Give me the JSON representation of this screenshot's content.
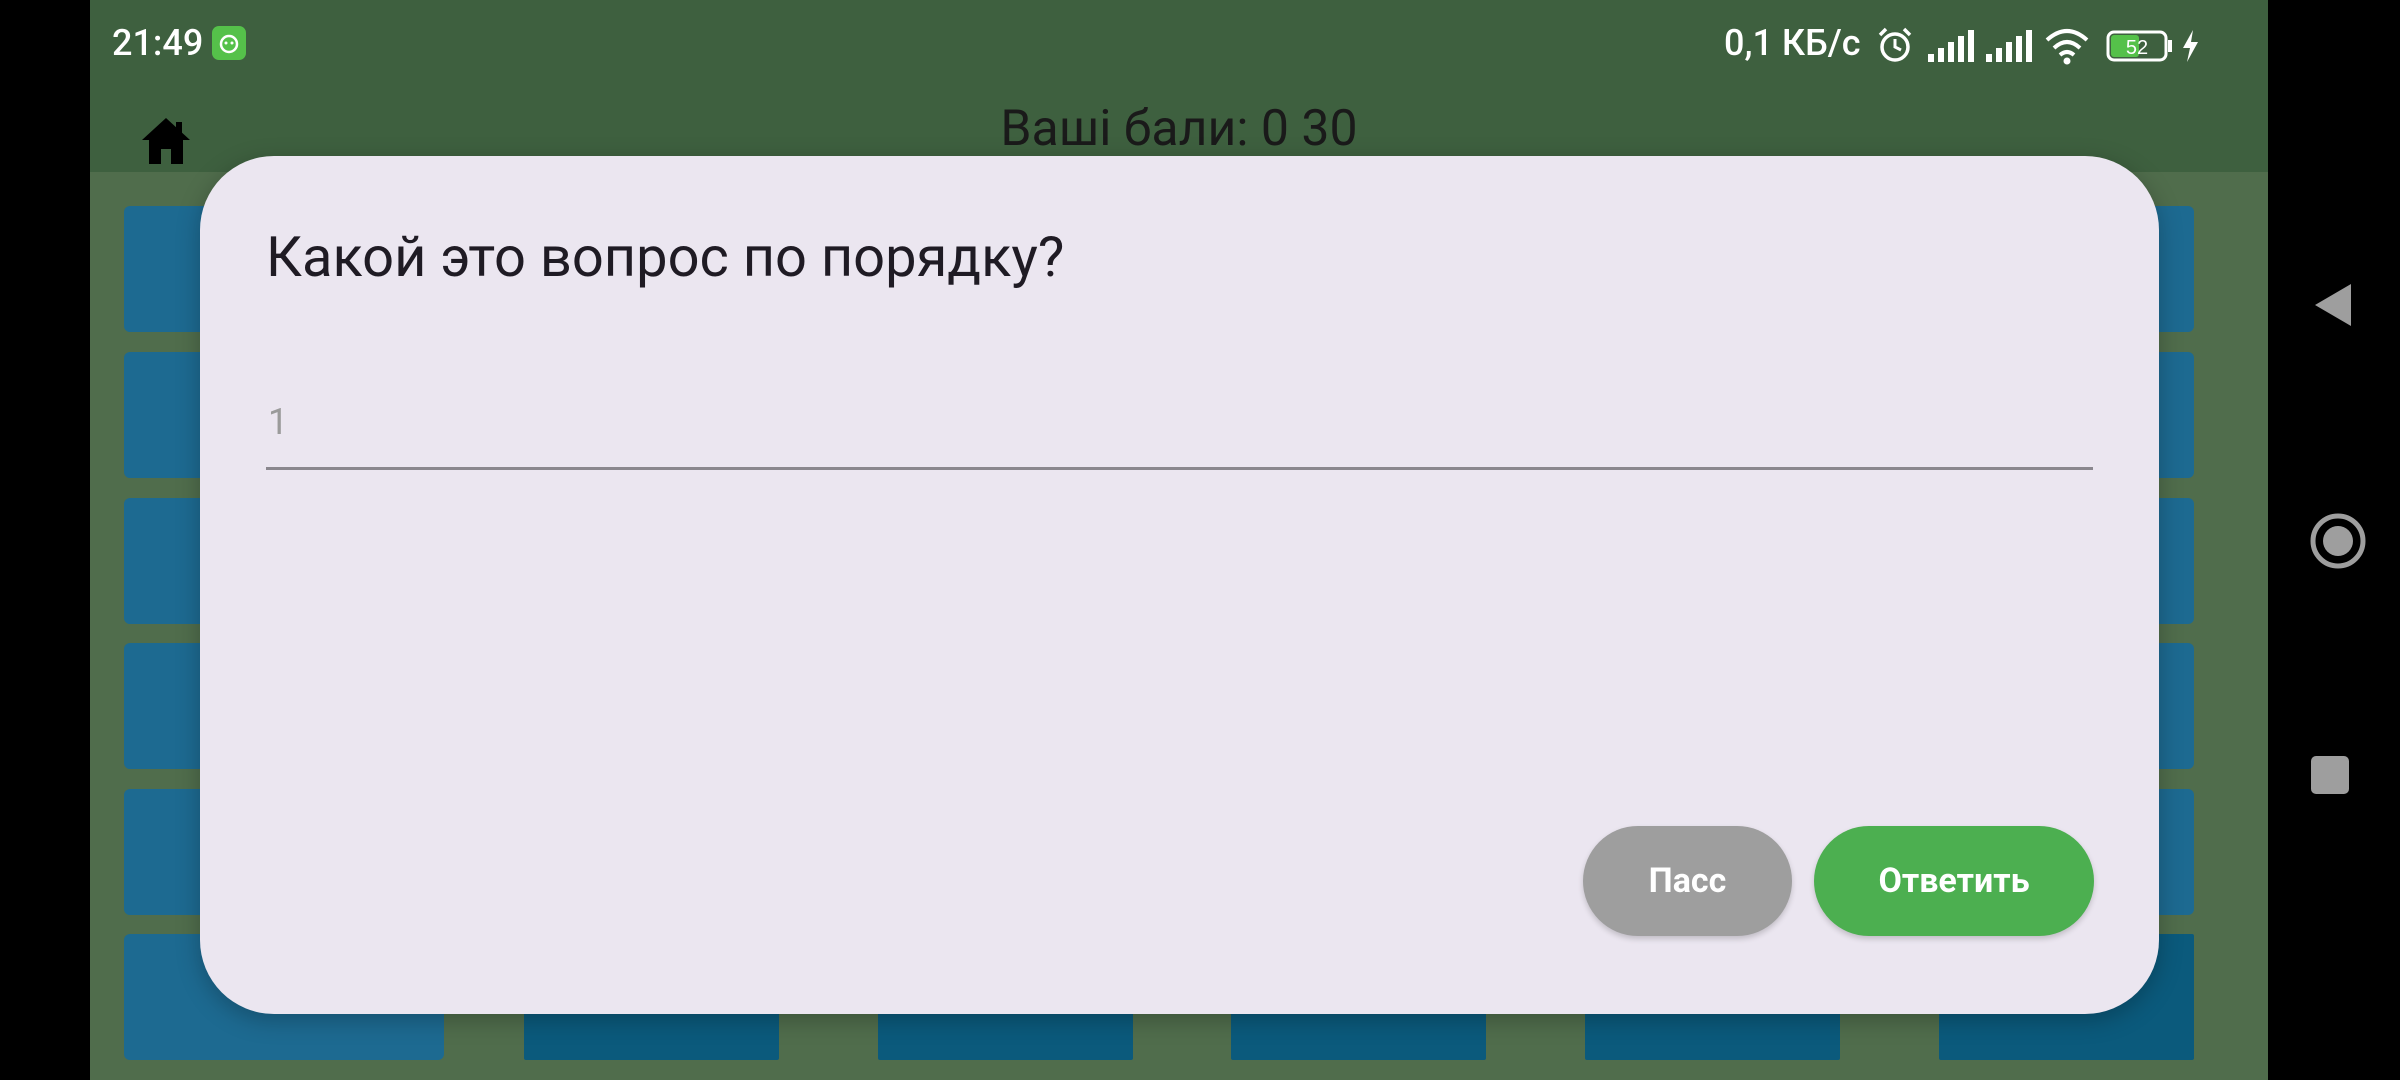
{
  "status_bar": {
    "time": "21:49",
    "net_speed": "0,1 КБ/с",
    "battery": "52",
    "icons": [
      "app-notification-icon",
      "alarm-icon",
      "signal-icon",
      "signal-icon",
      "wifi-icon",
      "battery-icon",
      "charging-icon"
    ]
  },
  "app_bar": {
    "score_text": "Ваші бали: 0 30",
    "home_icon": "home-icon"
  },
  "colors": {
    "app_background": "#3e603f",
    "tile": "#1d6a91",
    "dialog_background": "#ebe6f0",
    "pass_button": "#9e9e9e",
    "answer_button": "#4caf50"
  },
  "dialog": {
    "title": "Какой это вопрос по порядку?",
    "input_placeholder": "1",
    "input_value": "",
    "pass_label": "Пасс",
    "answer_label": "Ответить"
  },
  "nav_bar": {
    "icons": [
      "back-icon",
      "home-circle-icon",
      "recents-icon"
    ]
  }
}
